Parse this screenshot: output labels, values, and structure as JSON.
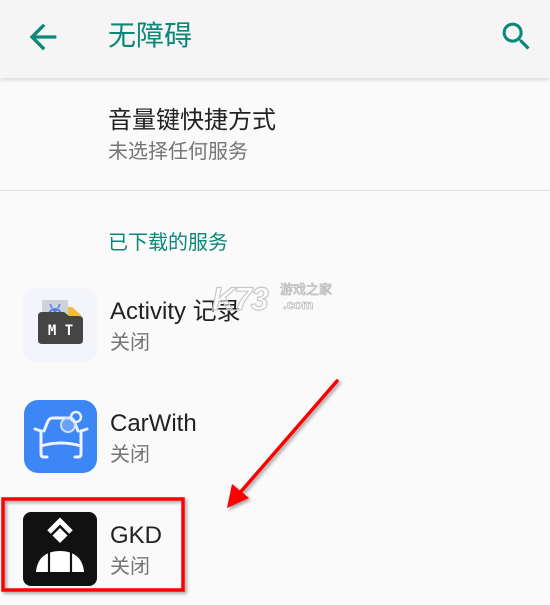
{
  "app_bar": {
    "title": "无障碍",
    "back_icon": "arrow-back-icon",
    "search_icon": "search-icon"
  },
  "shortcut": {
    "title": "音量键快捷方式",
    "summary": "未选择任何服务"
  },
  "downloaded_services": {
    "header": "已下载的服务",
    "items": [
      {
        "name": "Activity 记录",
        "status": "关闭",
        "icon": "mt-manager-icon",
        "icon_label": "M T"
      },
      {
        "name": "CarWith",
        "status": "关闭",
        "icon": "carwith-icon"
      },
      {
        "name": "GKD",
        "status": "关闭",
        "icon": "gkd-icon"
      }
    ]
  },
  "watermark": {
    "logo": "K73",
    "text": "游戏之家",
    "domain": ".com"
  },
  "annotation": {
    "type": "red arrow pointing to highlighted item",
    "highlighted_item": "GKD",
    "color": "#ff0000"
  },
  "colors": {
    "accent": "#0b8878",
    "app_bar_bg": "#f5f5f5",
    "page_bg": "#fafafa",
    "primary_text": "#212121",
    "secondary_text": "#757575",
    "carwith_blue": "#3d86f6",
    "gkd_black": "#111111"
  }
}
